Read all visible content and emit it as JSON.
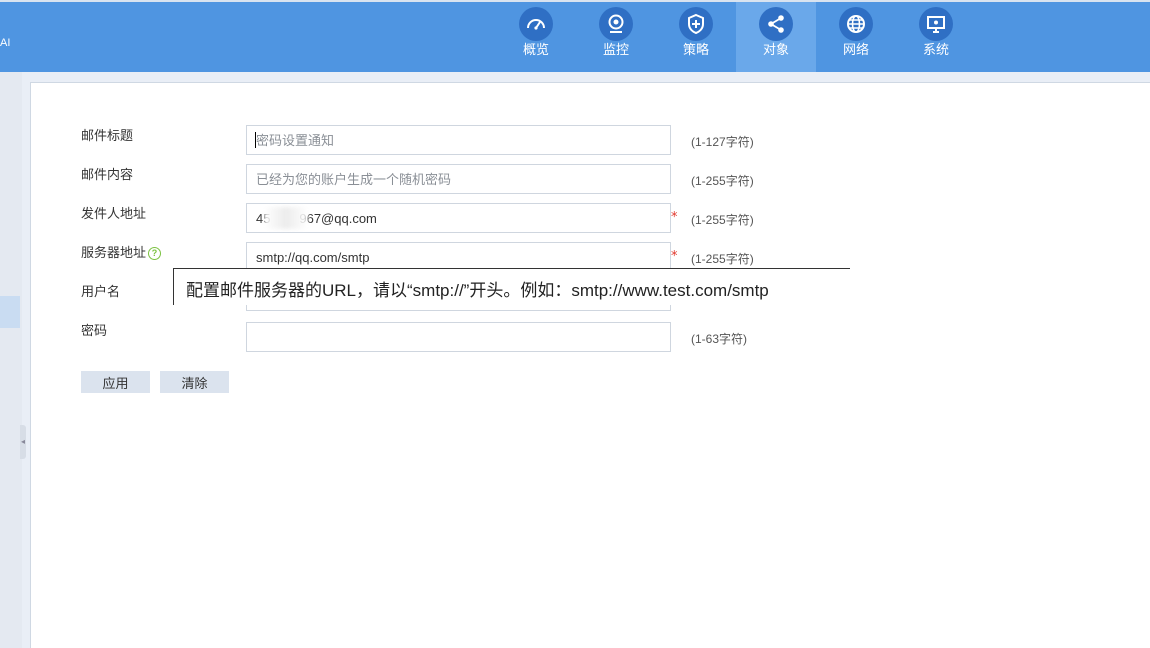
{
  "brand": "AI",
  "nav": {
    "items": [
      {
        "label": "概览",
        "icon": "speedometer-icon"
      },
      {
        "label": "监控",
        "icon": "webcam-icon"
      },
      {
        "label": "策略",
        "icon": "shield-icon"
      },
      {
        "label": "对象",
        "icon": "share-icon",
        "active": true
      },
      {
        "label": "网络",
        "icon": "globe-icon"
      },
      {
        "label": "系统",
        "icon": "monitor-icon"
      }
    ]
  },
  "form": {
    "subject": {
      "label": "邮件标题",
      "placeholder": "密码设置通知",
      "hint": "(1-127字符)"
    },
    "content": {
      "label": "邮件内容",
      "placeholder": "已经为您的账户生成一个随机密码",
      "hint": "(1-255字符)"
    },
    "sender": {
      "label": "发件人地址",
      "value": "45        967@qq.com",
      "hint": "(1-255字符)",
      "required": "*"
    },
    "server": {
      "label": "服务器地址",
      "value": "smtp://qq.com/smtp",
      "hint": "(1-255字符)",
      "required": "*",
      "help": "?"
    },
    "username": {
      "label": "用户名",
      "value": ""
    },
    "password": {
      "label": "密码",
      "value": "",
      "hint": "(1-63字符)"
    }
  },
  "buttons": {
    "apply": "应用",
    "clear": "清除"
  },
  "tooltip": "配置邮件服务器的URL，请以“smtp://”开头。例如：smtp://www.test.com/smtp",
  "colors": {
    "topbar": "#4f95e1",
    "active_tab": "#6aa8ea",
    "required": "#e0352b",
    "help": "#7cc242"
  }
}
